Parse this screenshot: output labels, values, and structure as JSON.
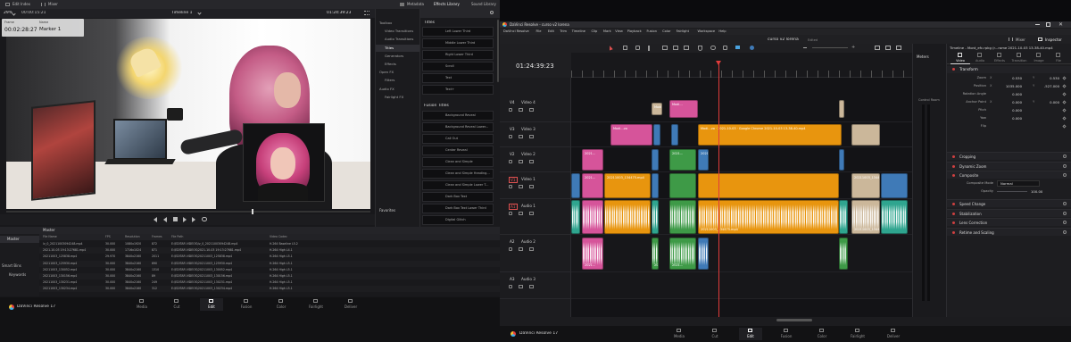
{
  "left": {
    "top_tabs": [
      "Edit Index",
      "Mixer"
    ],
    "zoom": "29%",
    "timecode_left": "00:00:15:21",
    "timeline_name": "Timeline 1",
    "timecode_right": "01:24:39:23",
    "marker": {
      "frame_label": "Frame",
      "frame": "00:02:28:27",
      "name_label": "Name",
      "name": "Marker 1"
    },
    "right_tabs": [
      "Metadata",
      "Effects Library",
      "Sound Library"
    ],
    "toolbox": [
      {
        "label": "Toolbox",
        "indent": 0
      },
      {
        "label": "Video Transitions",
        "indent": 1
      },
      {
        "label": "Audio Transitions",
        "indent": 1
      },
      {
        "label": "Titles",
        "indent": 1,
        "selected": true
      },
      {
        "label": "Generators",
        "indent": 1
      },
      {
        "label": "Effects",
        "indent": 1
      },
      {
        "label": "Open FX",
        "indent": 0
      },
      {
        "label": "Filters",
        "indent": 1
      },
      {
        "label": "Audio FX",
        "indent": 0
      },
      {
        "label": "Fairlight FX",
        "indent": 1
      }
    ],
    "favorites_label": "Favorites",
    "titles_header": "Titles",
    "titles": [
      "Left Lower Third",
      "Middle Lower Third",
      "Right Lower Third",
      "Scroll",
      "Text",
      "Text+"
    ],
    "fusion_titles_header": "Fusion Titles",
    "fusion_titles": [
      "Background Reveal",
      "Background Reveal Lower...",
      "Call Out",
      "Center Reveal",
      "Clean and Simple",
      "Clean and Simple Heading...",
      "Clean and Simple Lower T...",
      "Dark Box Text",
      "Dark Box Text Lower Third",
      "Digital Glitch"
    ],
    "pool": {
      "master_label": "Master",
      "bins": [
        "Master"
      ],
      "smart_bins": "Smart Bins",
      "keywords": "Keywords",
      "columns": [
        "File Name",
        "FPS",
        "Resolution",
        "Frames",
        "File Path",
        "Video Codec"
      ],
      "rows": [
        [
          "lv_0_20211003094248.mp4",
          "30.000",
          "1080x1920",
          "872",
          "E:\\EDITAR VIDEOS\\lv_0_20211003094248.mp4",
          "H.264 Baseline L5.2"
        ],
        [
          "2021-10-03 19:13:27681.mp4",
          "30.000",
          "1716x1024",
          "871",
          "E:\\EDITAR VIDEOS\\2021-10-03 19:13:27681.mp4",
          "H.264 High L4.1"
        ],
        [
          "20211003_125838.mp4",
          "29.970",
          "3840x2160",
          "2011",
          "E:\\EDITAR VIDEOS\\20211003_125838.mp4",
          "H.264 High L5.1"
        ],
        [
          "20211003_125930.mp4",
          "30.000",
          "3840x2160",
          "690",
          "E:\\EDITAR VIDEOS\\20211003_125930.mp4",
          "H.264 High L5.1"
        ],
        [
          "20211003_130052.mp4",
          "30.000",
          "3840x2160",
          "1310",
          "E:\\EDITAR VIDEOS\\20211003_130052.mp4",
          "H.264 High L5.1"
        ],
        [
          "20211003_130156.mp4",
          "30.000",
          "3840x2160",
          "89",
          "E:\\EDITAR VIDEOS\\20211003_130156.mp4",
          "H.264 High L5.1"
        ],
        [
          "20211003_130231.mp4",
          "30.000",
          "3840x2160",
          "249",
          "E:\\EDITAR VIDEOS\\20211003_130231.mp4",
          "H.264 High L5.1"
        ],
        [
          "20211003_130234.mp4",
          "30.000",
          "3840x2160",
          "312",
          "E:\\EDITAR VIDEOS\\20211003_130234.mp4",
          "H.264 High L5.1"
        ]
      ]
    },
    "app_name": "DaVinci Resolve 17",
    "pages": [
      "Media",
      "Cut",
      "Edit",
      "Fusion",
      "Color",
      "Fairlight",
      "Deliver"
    ],
    "active_page": "Edit"
  },
  "right": {
    "title_bar": "DaVinci Resolve - curso v2 lorena",
    "menu": [
      "DaVinci Resolve",
      "File",
      "Edit",
      "Trim",
      "Timeline",
      "Clip",
      "Mark",
      "View",
      "Playback",
      "Fusion",
      "Color",
      "Fairlight",
      "Workspace",
      "Help"
    ],
    "project_name": "curso v2 lorena",
    "edited": "Edited",
    "top_right_tabs": [
      "Mixer",
      "Inspector"
    ],
    "timecode": "01:24:39:23",
    "tracks": [
      {
        "id": "V4",
        "name": "Video 4"
      },
      {
        "id": "V3",
        "name": "Video 3"
      },
      {
        "id": "V2",
        "name": "Video 2"
      },
      {
        "id": "V1",
        "name": "Video 1"
      },
      {
        "id": "A1",
        "name": "Audio 1"
      },
      {
        "id": "A2",
        "name": "Audio 2"
      },
      {
        "id": "A3",
        "name": "Audio 3"
      }
    ],
    "clip_labels": {
      "v4a": "Modi...",
      "v4b": "Modi...",
      "v3a": "Modi...vo",
      "v3b": "Modi...vo · 2021-10-03 · Google Chrome 2021-10-03 13-38-40.mp4",
      "v2a": "2021...",
      "v2c": "2021...",
      "v2d": "20211...",
      "v1a": "2021...",
      "v1b": "20211003_134475.mp4",
      "v1c": "20211...",
      "v1d": "20211003_134475.mp4",
      "a1b": "20211003_134475.mp4",
      "a1d": "20211003_134475.mp4",
      "a2a": "2021...",
      "a2b": "2021...",
      "a2c": "2021..."
    },
    "meters_label": "Meters",
    "meters_sub": "Control Room",
    "inspector": {
      "title": "Timeline - Mont_efc.rpkg (r...rome 2021-10-03 13-38-40.mp4",
      "tabs": [
        "Video",
        "Audio",
        "Effects",
        "Transition",
        "Image",
        "File"
      ],
      "transform": "Transform",
      "rows": [
        {
          "label": "Zoom",
          "x_label": "X",
          "x": "0.530",
          "y_label": "Y",
          "y": "0.530"
        },
        {
          "label": "Position",
          "x_label": "X",
          "x": "1035.000",
          "y_label": "Y",
          "y": "-527.000"
        },
        {
          "label": "Rotation Angle",
          "x": "0.000"
        },
        {
          "label": "Anchor Point",
          "x_label": "X",
          "x": "0.000",
          "y_label": "Y",
          "y": "0.000"
        },
        {
          "label": "Pitch",
          "x": "0.000"
        },
        {
          "label": "Yaw",
          "x": "0.000"
        },
        {
          "label": "Flip",
          "x": ""
        }
      ],
      "sections": [
        "Cropping",
        "Dynamic Zoom",
        "Composite"
      ],
      "composite_mode_label": "Composite Mode",
      "composite_mode": "Normal",
      "opacity_label": "Opacity",
      "opacity": "100.00",
      "more_sections": [
        "Speed Change",
        "Stabilization",
        "Lens Correction",
        "Retime and Scaling"
      ]
    },
    "app_name": "DaVinci Resolve 17",
    "pages": [
      "Media",
      "Cut",
      "Edit",
      "Fusion",
      "Color",
      "Fairlight",
      "Deliver"
    ],
    "active_page": "Edit"
  },
  "colors": {
    "accent_orange": "#e8950e",
    "pink": "#d6549a",
    "blue": "#3f7ab7",
    "green": "#3e9a47",
    "beige": "#cbb79a",
    "teal": "#2fa58f",
    "playhead": "#e03b3b"
  }
}
